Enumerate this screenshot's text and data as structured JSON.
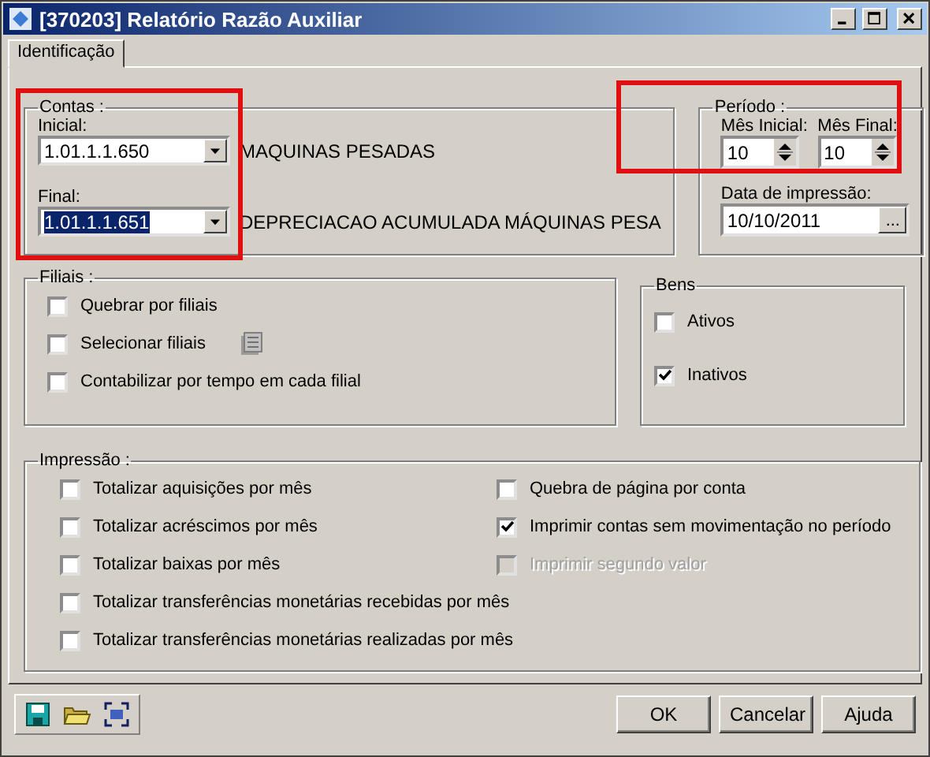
{
  "window": {
    "title": "[370203]  Relatório Razão Auxiliar"
  },
  "tabs": [
    {
      "label": "Identificação",
      "selected": true
    }
  ],
  "contas": {
    "title": "Contas :",
    "highlighted": true,
    "fields": [
      {
        "label": "Inicial:",
        "value": "1.01.1.1.650",
        "description": "MAQUINAS PESADAS",
        "selected": false
      },
      {
        "label": "Final:",
        "value": "1.01.1.1.651",
        "description": "DEPRECIACAO ACUMULADA MÁQUINAS PESA",
        "selected": true
      }
    ]
  },
  "periodo": {
    "title": "Período :",
    "highlighted": true,
    "spinners": [
      {
        "label": "Mês Inicial:",
        "value": "10"
      },
      {
        "label": "Mês Final:",
        "value": "10"
      }
    ],
    "date": {
      "label": "Data de impressão:",
      "value": "10/10/2011",
      "button": "..."
    }
  },
  "filiais": {
    "title": "Filiais :",
    "options": [
      {
        "kind": "checkbox",
        "label": "Quebrar por filiais",
        "checked": false
      },
      {
        "kind": "picker",
        "label": "Selecionar filiais",
        "checked": false
      },
      {
        "kind": "checkbox",
        "label": "Contabilizar por tempo em cada filial",
        "checked": false
      }
    ]
  },
  "bens": {
    "title": "Bens",
    "options": [
      {
        "label": "Ativos",
        "checked": false
      },
      {
        "label": "Inativos",
        "checked": true
      }
    ]
  },
  "impressao": {
    "title": "Impressão :",
    "columns": [
      [
        {
          "label": "Totalizar aquisições por mês",
          "checked": false,
          "disabled": false
        },
        {
          "label": "Totalizar acréscimos por mês",
          "checked": false,
          "disabled": false
        },
        {
          "label": "Totalizar baixas por mês",
          "checked": false,
          "disabled": false
        },
        {
          "label": "Totalizar transferências monetárias recebidas por mês",
          "checked": false,
          "disabled": false
        },
        {
          "label": "Totalizar transferências monetárias realizadas por mês",
          "checked": false,
          "disabled": false
        }
      ],
      [
        {
          "label": "Quebra de página por conta",
          "checked": false,
          "disabled": false
        },
        {
          "label": "Imprimir contas sem movimentação no período",
          "checked": true,
          "disabled": false
        },
        {
          "label": "Imprimir segundo valor",
          "checked": false,
          "disabled": true
        }
      ]
    ]
  },
  "buttons": [
    {
      "label": "OK"
    },
    {
      "label": "Cancelar"
    },
    {
      "label": "Ajuda"
    }
  ]
}
